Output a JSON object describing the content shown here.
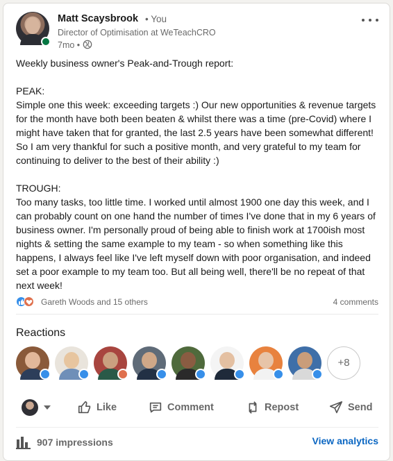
{
  "author": {
    "name": "Matt Scaysbrook",
    "relation": "• You",
    "headline": "Director of Optimisation at WeTeachCRO",
    "time": "7mo •"
  },
  "post": {
    "text": "Weekly business owner's Peak-and-Trough report:\n\nPEAK:\nSimple one this week: exceeding targets :) Our new opportunities & revenue targets for the month have both been beaten & whilst there was a time (pre-Covid) where I might have taken that for granted, the last 2.5 years have been somewhat different! So I am very thankful for such a positive month, and very grateful to my team for continuing to deliver to the best of their ability :)\n\nTROUGH:\nToo many tasks, too little time. I worked until almost 1900 one day this week, and I can probably count on one hand the number of times I've done that in my 6 years of business owner. I'm personally proud of being able to finish work at 1700ish most nights & setting the same example to my team - so when something like this happens, I always feel like I've left myself down with poor organisation, and indeed set a poor example to my team too. But all being well, there'll be no repeat of that next week!"
  },
  "social": {
    "reactors": "Gareth Woods and 15 others",
    "comments": "4 comments"
  },
  "reactions": {
    "title": "Reactions",
    "more": "+8"
  },
  "actions": {
    "like": "Like",
    "comment": "Comment",
    "repost": "Repost",
    "send": "Send"
  },
  "footer": {
    "impressions": "907 impressions",
    "analytics": "View analytics"
  },
  "colors": {
    "accent": "#0a66c2",
    "like": "#378fe9",
    "love": "#df704d",
    "online": "#057642"
  }
}
